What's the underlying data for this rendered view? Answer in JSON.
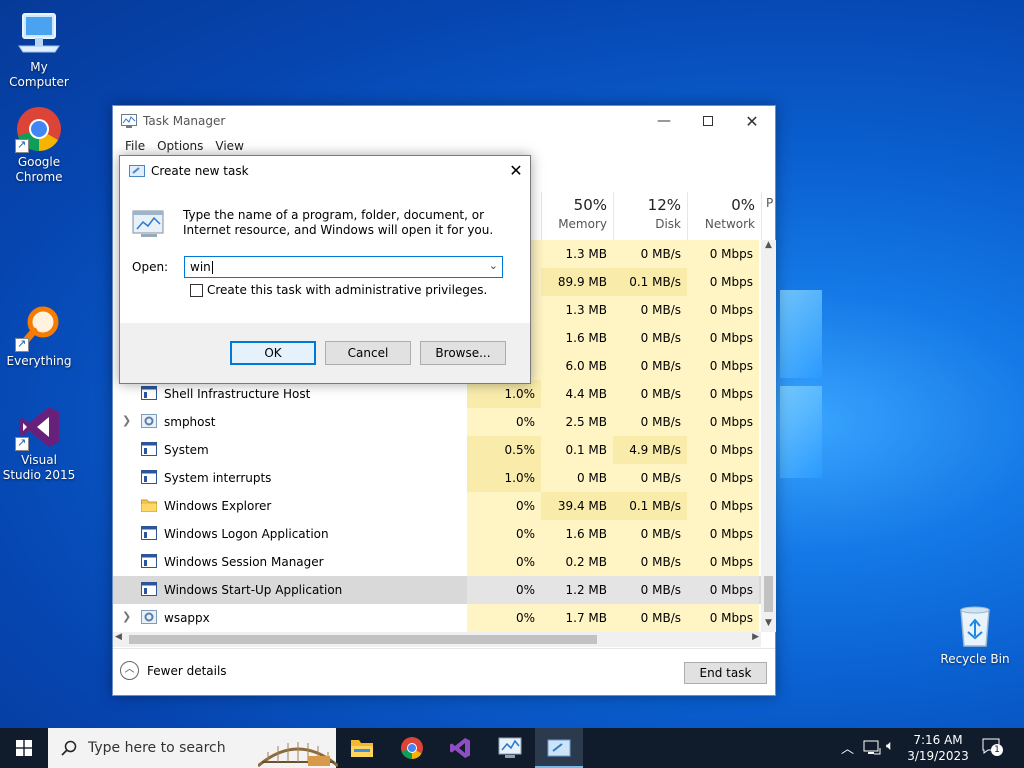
{
  "desktop": {
    "icons": [
      {
        "label": "My Computer"
      },
      {
        "label": "Google Chrome"
      },
      {
        "label": "Everything"
      },
      {
        "label": "Visual Studio 2015"
      },
      {
        "label": "Recycle Bin"
      }
    ]
  },
  "task_manager": {
    "title": "Task Manager",
    "menu": [
      "File",
      "Options",
      "View"
    ],
    "columns": [
      {
        "pct": "50%",
        "label": "Memory"
      },
      {
        "pct": "12%",
        "label": "Disk"
      },
      {
        "pct": "0%",
        "label": "Network"
      },
      {
        "pct": "",
        "label": "P"
      }
    ],
    "hidden_rows": [
      {
        "mem": "1.3 MB",
        "disk": "0 MB/s",
        "net": "0 Mbps"
      },
      {
        "mem": "89.9 MB",
        "disk": "0.1 MB/s",
        "net": "0 Mbps"
      },
      {
        "mem": "1.3 MB",
        "disk": "0 MB/s",
        "net": "0 Mbps"
      },
      {
        "mem": "1.6 MB",
        "disk": "0 MB/s",
        "net": "0 Mbps"
      },
      {
        "mem": "6.0 MB",
        "disk": "0 MB/s",
        "net": "0 Mbps"
      }
    ],
    "rows": [
      {
        "name": "Shell Infrastructure Host",
        "cpu": "1.0%",
        "mem": "4.4 MB",
        "disk": "0 MB/s",
        "net": "0 Mbps"
      },
      {
        "name": "smphost",
        "cpu": "0%",
        "mem": "2.5 MB",
        "disk": "0 MB/s",
        "net": "0 Mbps"
      },
      {
        "name": "System",
        "cpu": "0.5%",
        "mem": "0.1 MB",
        "disk": "4.9 MB/s",
        "net": "0 Mbps"
      },
      {
        "name": "System interrupts",
        "cpu": "1.0%",
        "mem": "0 MB",
        "disk": "0 MB/s",
        "net": "0 Mbps"
      },
      {
        "name": "Windows Explorer",
        "cpu": "0%",
        "mem": "39.4 MB",
        "disk": "0.1 MB/s",
        "net": "0 Mbps"
      },
      {
        "name": "Windows Logon Application",
        "cpu": "0%",
        "mem": "1.6 MB",
        "disk": "0 MB/s",
        "net": "0 Mbps"
      },
      {
        "name": "Windows Session Manager",
        "cpu": "0%",
        "mem": "0.2 MB",
        "disk": "0 MB/s",
        "net": "0 Mbps"
      },
      {
        "name": "Windows Start-Up Application",
        "cpu": "0%",
        "mem": "1.2 MB",
        "disk": "0 MB/s",
        "net": "0 Mbps"
      },
      {
        "name": "wsappx",
        "cpu": "0%",
        "mem": "1.7 MB",
        "disk": "0 MB/s",
        "net": "0 Mbps"
      }
    ],
    "fewer_details": "Fewer details",
    "end_task": "End task"
  },
  "run_dialog": {
    "title": "Create new task",
    "description": "Type the name of a program, folder, document, or Internet resource, and Windows will open it for you.",
    "open_label": "Open:",
    "input_value": "win",
    "admin_checkbox_label": "Create this task with administrative privileges.",
    "ok": "OK",
    "cancel": "Cancel",
    "browse": "Browse..."
  },
  "taskbar": {
    "search_placeholder": "Type here to search",
    "time": "7:16 AM",
    "date": "3/19/2023",
    "notification_count": "1"
  }
}
